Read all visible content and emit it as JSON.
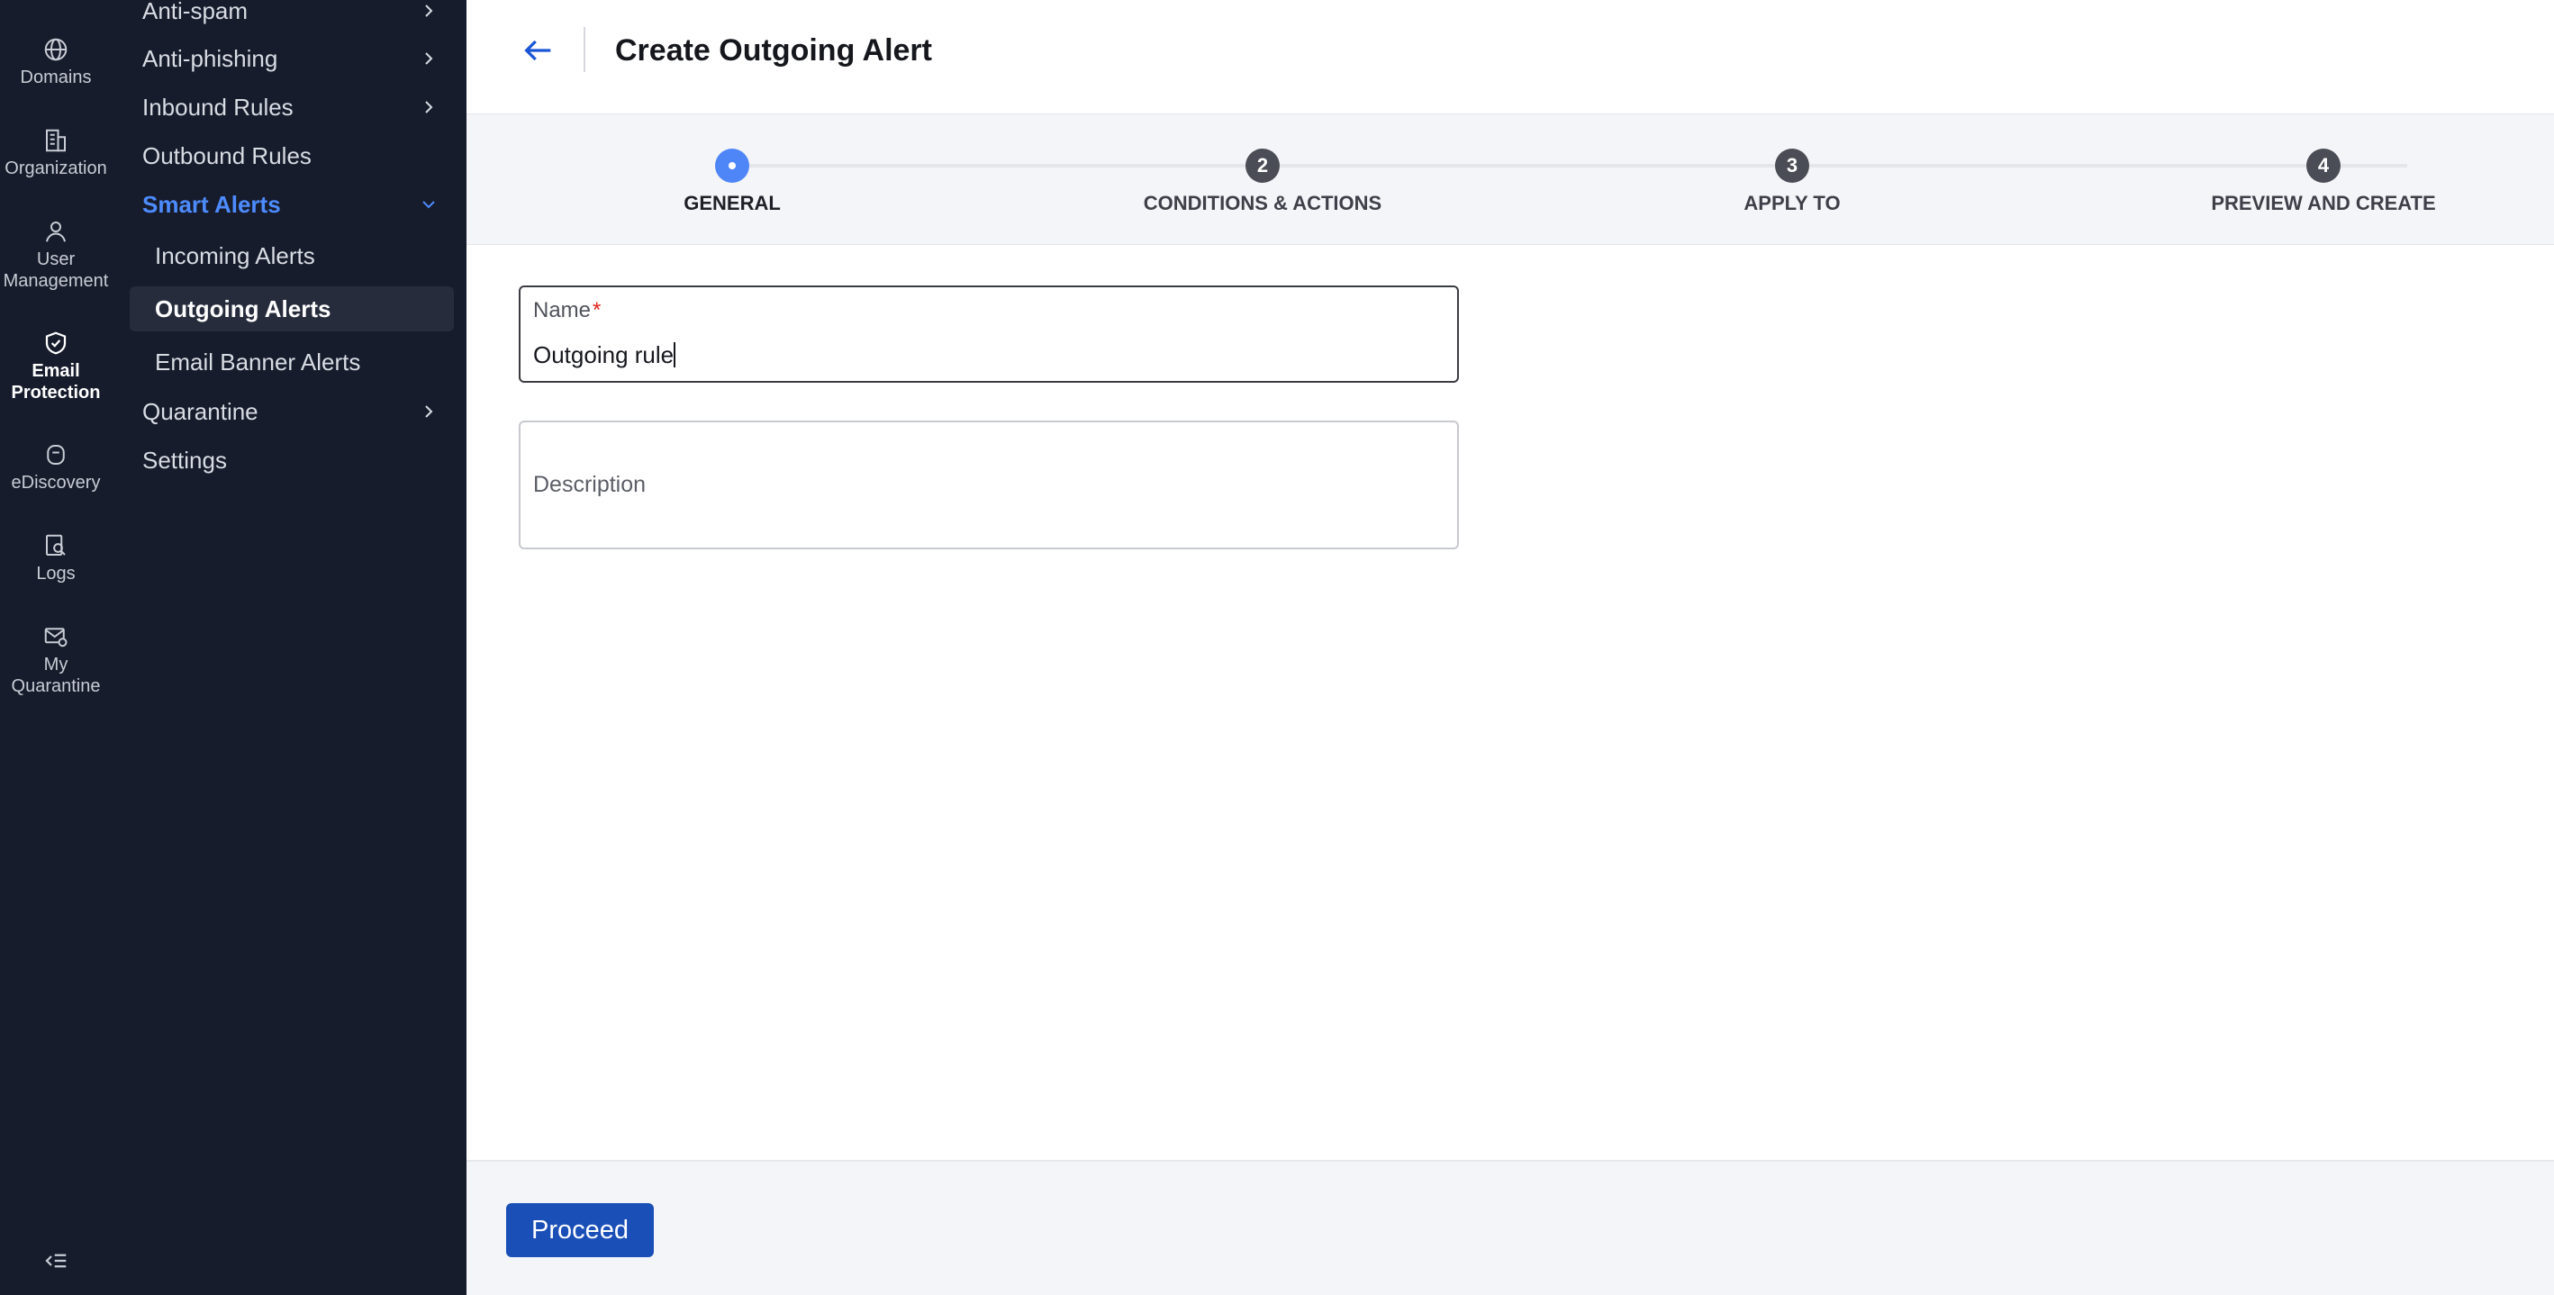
{
  "rail": {
    "items": [
      {
        "label": "Domains",
        "icon": "globe-icon"
      },
      {
        "label": "Organization",
        "icon": "building-icon"
      },
      {
        "label": "User Management",
        "icon": "user-icon"
      },
      {
        "label": "Email Protection",
        "icon": "shield-icon",
        "active": true
      },
      {
        "label": "eDiscovery",
        "icon": "archive-icon"
      },
      {
        "label": "Logs",
        "icon": "log-search-icon"
      },
      {
        "label": "My Quarantine",
        "icon": "mail-quarantine-icon"
      }
    ],
    "collapse_icon": "collapse-menu-icon"
  },
  "subnav": {
    "anti_spam": "Anti-spam",
    "anti_phishing": "Anti-phishing",
    "inbound_rules": "Inbound Rules",
    "outbound_rules": "Outbound Rules",
    "smart_alerts": "Smart Alerts",
    "incoming_alerts": "Incoming Alerts",
    "outgoing_alerts": "Outgoing Alerts",
    "email_banner_alerts": "Email Banner Alerts",
    "quarantine": "Quarantine",
    "settings": "Settings"
  },
  "header": {
    "title": "Create Outgoing Alert",
    "back_icon": "arrow-left-icon"
  },
  "stepper": {
    "steps": [
      {
        "number": "",
        "label": "GENERAL",
        "active": true
      },
      {
        "number": "2",
        "label": "CONDITIONS & ACTIONS"
      },
      {
        "number": "3",
        "label": "APPLY TO"
      },
      {
        "number": "4",
        "label": "PREVIEW AND CREATE"
      }
    ]
  },
  "form": {
    "name_label": "Name",
    "name_required": "*",
    "name_value": "Outgoing rule",
    "description_placeholder": "Description"
  },
  "footer": {
    "proceed_label": "Proceed"
  },
  "colors": {
    "sidebar_bg": "#161c2c",
    "accent": "#4d8bff",
    "primary_button": "#1a4fb8",
    "step_active": "#4f86f7",
    "required": "#e0241c"
  }
}
